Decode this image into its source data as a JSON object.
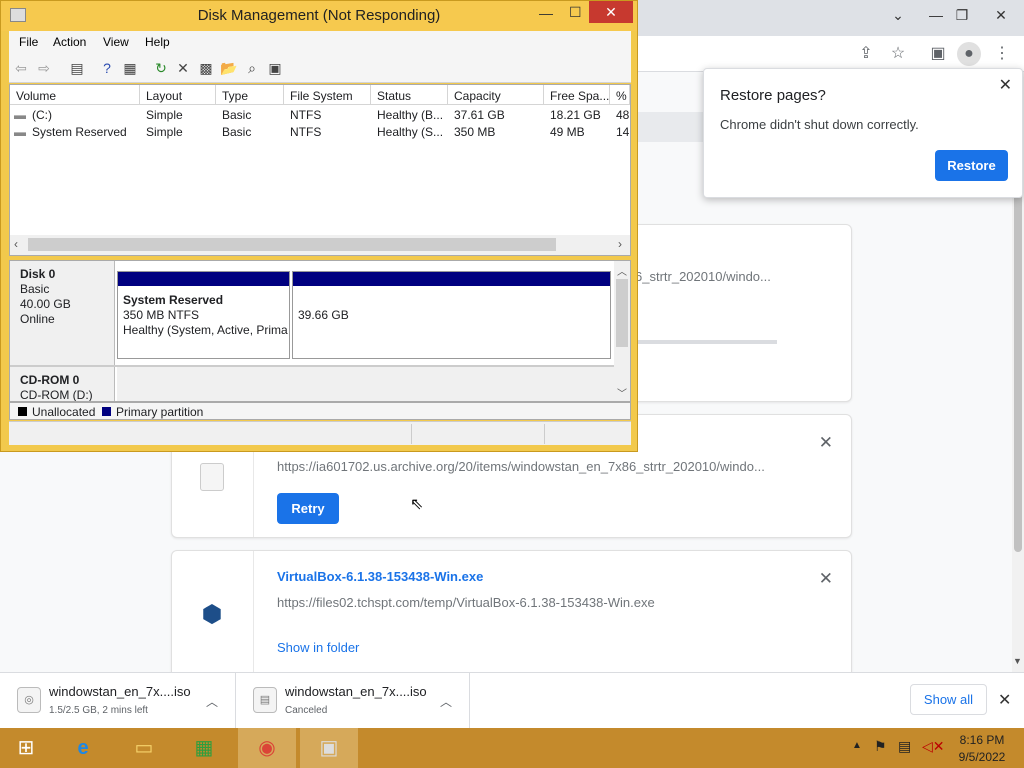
{
  "disk_management": {
    "title": "Disk Management (Not Responding)",
    "menu": [
      "File",
      "Action",
      "View",
      "Help"
    ],
    "columns": [
      "Volume",
      "Layout",
      "Type",
      "File System",
      "Status",
      "Capacity",
      "Free Spa...",
      "% F"
    ],
    "rows": [
      [
        "(C:)",
        "Simple",
        "Basic",
        "NTFS",
        "Healthy (B...",
        "37.61 GB",
        "18.21 GB",
        "48"
      ],
      [
        "System Reserved",
        "Simple",
        "Basic",
        "NTFS",
        "Healthy (S...",
        "350 MB",
        "49 MB",
        "14"
      ]
    ],
    "disk0": {
      "name": "Disk 0",
      "type": "Basic",
      "size": "40.00 GB",
      "state": "Online"
    },
    "partition1": {
      "name": "System Reserved",
      "size": "350 MB NTFS",
      "status": "Healthy (System, Active, Prima"
    },
    "partition2": {
      "size": "39.66 GB"
    },
    "cdrom": {
      "name": "CD-ROM 0",
      "drive": "CD-ROM (D:)"
    },
    "legend": {
      "unallocated": "Unallocated",
      "primary": "Primary partition"
    }
  },
  "restore_popup": {
    "title": "Restore pages?",
    "message": "Chrome didn't shut down correctly.",
    "button": "Restore"
  },
  "downloads": {
    "card1": {
      "url": "6_strtr_202010/windo..."
    },
    "card2": {
      "url": "https://ia601702.us.archive.org/20/items/windowstan_en_7x86_strtr_202010/windo...",
      "button": "Retry"
    },
    "card3": {
      "name": "VirtualBox-6.1.38-153438-Win.exe",
      "url": "https://files02.tchspt.com/temp/VirtualBox-6.1.38-153438-Win.exe",
      "link": "Show in folder"
    }
  },
  "shelf": {
    "item1": {
      "name": "windowstan_en_7x....iso",
      "status": "1.5/2.5 GB, 2 mins left"
    },
    "item2": {
      "name": "windowstan_en_7x....iso",
      "status": "Canceled"
    },
    "show_all": "Show all"
  },
  "taskbar": {
    "time": "8:16 PM",
    "date": "9/5/2022"
  },
  "colors": {
    "accent": "#1a73e8",
    "taskbar": "#c48a2c",
    "primary_partition": "#000080",
    "window_frame": "#f2c94c"
  }
}
